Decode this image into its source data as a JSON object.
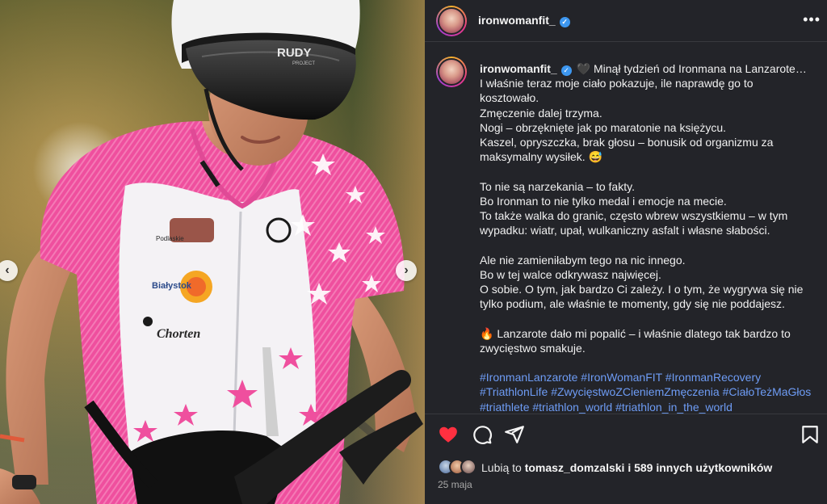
{
  "post": {
    "username": "ironwomanfit_",
    "verified_glyph": "✓",
    "more_icon": "more-horizontal-icon"
  },
  "photo": {
    "helmet_brand": "RUDY",
    "helmet_sub": "PROJECT",
    "sponsors": [
      "Podlaskie",
      "Białystok",
      "Chorten"
    ],
    "prev_glyph": "‹",
    "next_glyph": "›"
  },
  "caption": {
    "username": "ironwomanfit_",
    "lines": [
      "🖤 Minął tydzień od Ironmana na Lanzarote…",
      "I właśnie teraz moje ciało pokazuje, ile naprawdę go to",
      "kosztowało.",
      "Zmęczenie dalej trzyma.",
      "Nogi – obrzęknięte jak po maratonie na księżycu.",
      "Kaszel, opryszczka, brak głosu – bonusik od organizmu za",
      "maksymalny wysiłek. 😅",
      "",
      "To nie są narzekania – to fakty.",
      "Bo Ironman to nie tylko medal i emocje na mecie.",
      "To także walka do granic, często wbrew wszystkiemu – w tym",
      "wypadku: wiatr, upał, wulkaniczny asfalt i własne słabości.",
      "",
      "Ale nie zamieniłabym tego na nic innego.",
      "Bo w tej walce odkrywasz najwięcej.",
      "O sobie. O tym, jak bardzo Ci zależy. I o tym, że wygrywa się nie",
      "tylko podium, ale właśnie te momenty, gdy się nie poddajesz.",
      "",
      "🔥 Lanzarote dało mi popalić – i właśnie dlatego tak bardzo to",
      "zwycięstwo smakuje.",
      ""
    ],
    "hashtag_lines": [
      "#IronmanLanzarote #IronWomanFIT #IronmanRecovery",
      "#TriathlonLife #ZwycięstwoZCieniemZmęczenia #CiałoTeżMaGłos",
      "#triathlete #triathlon_world #triathlon_in_the_world"
    ]
  },
  "actions": {
    "like_icon": "heart-filled-icon",
    "comment_icon": "comment-icon",
    "share_icon": "send-icon",
    "save_icon": "bookmark-icon",
    "like_color": "#ff3040"
  },
  "likes": {
    "prefix": "Lubią to ",
    "user": "tomasz_domzalski",
    "suffix": " i 589 innych użytkowników"
  },
  "date": "25 maja"
}
